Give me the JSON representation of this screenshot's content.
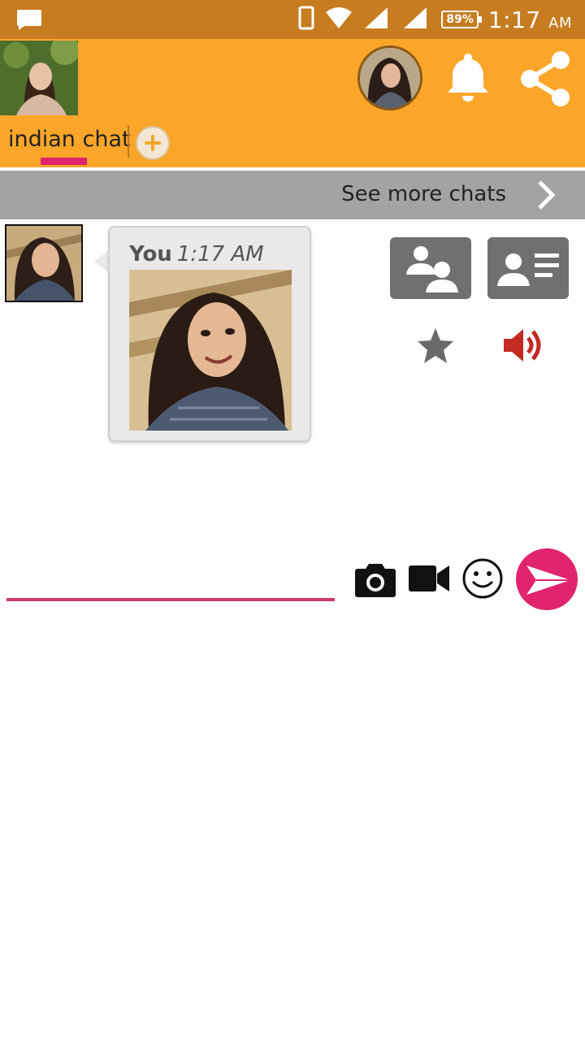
{
  "status_bar": {
    "battery": "89%",
    "time": "1:17",
    "ampm": "AM"
  },
  "header": {
    "tab_label": "indian chat"
  },
  "see_more": {
    "label": "See more chats"
  },
  "message": {
    "sender": "You",
    "time": "1:17 AM"
  },
  "icons": {
    "status_message": "message-icon",
    "phone": "phone-icon",
    "wifi": "wifi-icon",
    "signal": "signal-icon",
    "bell": "bell-icon",
    "share": "share-icon",
    "add_tab": "plus-icon",
    "chevron": "chevron-right-icon",
    "group": "group-icon",
    "profile_card": "profile-card-icon",
    "star": "star-icon",
    "speaker": "speaker-icon",
    "camera": "camera-icon",
    "video": "video-icon",
    "emoji": "emoji-icon",
    "send": "send-icon"
  },
  "colors": {
    "header_bg": "#fba629",
    "status_bg": "#c77c20",
    "accent": "#e0246d",
    "see_more_bg": "#a3a3a3"
  }
}
